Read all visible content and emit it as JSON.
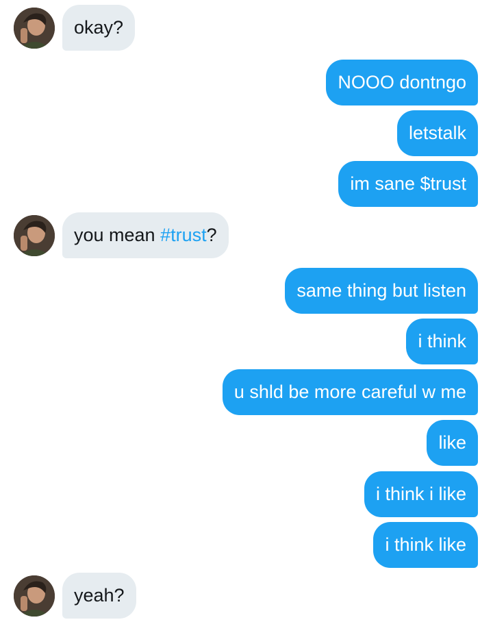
{
  "colors": {
    "incoming_bubble": "#e6ecf0",
    "outgoing_bubble": "#1da1f2",
    "hashtag": "#1da1f2"
  },
  "messages": [
    {
      "side": "incoming",
      "text": "okay?"
    },
    {
      "side": "outgoing",
      "text": "NOOO dontngo"
    },
    {
      "side": "outgoing",
      "text": "letstalk"
    },
    {
      "side": "outgoing",
      "text": "im sane $trust"
    },
    {
      "side": "incoming",
      "prefix": "you mean ",
      "hashtag": "#trust",
      "suffix": "?"
    },
    {
      "side": "outgoing",
      "text": "same thing but listen"
    },
    {
      "side": "outgoing",
      "text": "i think"
    },
    {
      "side": "outgoing",
      "text": "u shld be more careful w me"
    },
    {
      "side": "outgoing",
      "text": "like"
    },
    {
      "side": "outgoing",
      "text": "i think i like"
    },
    {
      "side": "outgoing",
      "text": "i think like"
    },
    {
      "side": "incoming",
      "text": "yeah?"
    }
  ]
}
